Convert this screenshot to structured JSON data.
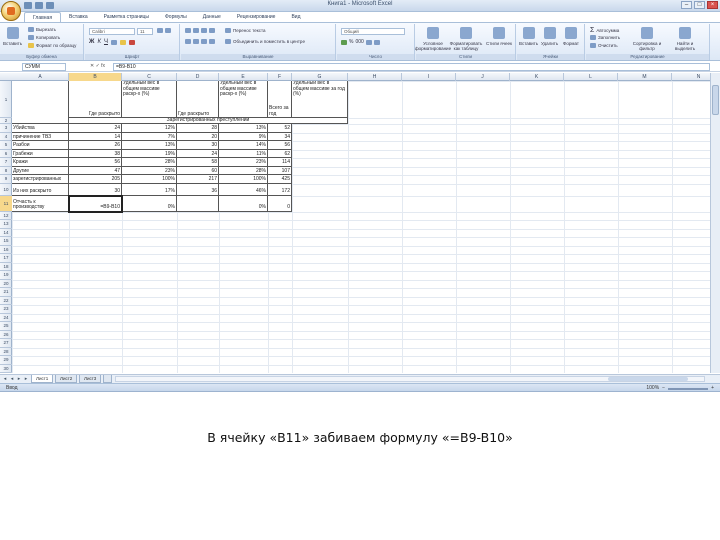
{
  "window": {
    "title": "Книга1 - Microsoft Excel"
  },
  "tabs": [
    "Главная",
    "Вставка",
    "Разметка страницы",
    "Формулы",
    "Данные",
    "Рецензирование",
    "Вид"
  ],
  "ribbon": {
    "paste": "Вставить",
    "cut": "Вырезать",
    "copy": "Копировать",
    "format_painter": "Формат по образцу",
    "font_name": "Calibri",
    "font_size": "11",
    "wrap_text": "Перенос текста",
    "merge_center": "Объединить и поместить в центре",
    "number_format": "Общий",
    "cond_format": "Условное форматирование",
    "format_table": "Форматировать как таблицу",
    "cell_styles": "Стили ячеек",
    "insert": "Вставить",
    "delete": "Удалить",
    "format": "Формат",
    "autosum": "Автосумма",
    "fill": "Заполнить",
    "clear": "Очистить",
    "sort_filter": "Сортировка и фильтр",
    "find_select": "Найти и выделить",
    "groups": [
      "Буфер обмена",
      "Шрифт",
      "Выравнивание",
      "Число",
      "Стили",
      "Ячейки",
      "Редактирование"
    ]
  },
  "formula_bar": {
    "name_box": "СУММ",
    "fx": "✕ ✓ fx",
    "formula": "=B9-B10"
  },
  "columns": [
    "A",
    "B",
    "C",
    "D",
    "E",
    "F",
    "G",
    "H",
    "I",
    "J",
    "K",
    "L",
    "M",
    "N",
    "O",
    "P"
  ],
  "rows": [
    "1",
    "2",
    "3",
    "4",
    "5",
    "6",
    "7",
    "8",
    "9",
    "10",
    "11",
    "12",
    "13",
    "14",
    "15",
    "16",
    "17",
    "18",
    "19",
    "20",
    "21",
    "22",
    "23",
    "24",
    "25",
    "26",
    "27",
    "28",
    "29",
    "30",
    "31"
  ],
  "table": {
    "header": {
      "b": "Где раскрыто",
      "c": "Удельный вес в общем массиве раскр-х (%)",
      "d": "Где раскрыто",
      "e": "Удельный вес в общем массиве раскр-х (%)",
      "f": "Всего за год",
      "g": "Удельный вес в общем массиве за год (%)",
      "sub": "Зарегистрированных преступлений"
    },
    "rows": [
      [
        "Убийства",
        "24",
        "12%",
        "28",
        "13%",
        "52"
      ],
      [
        "Умышленное причинение ТВЗ",
        "14",
        "7%",
        "20",
        "9%",
        "34"
      ],
      [
        "Разбои",
        "26",
        "13%",
        "30",
        "14%",
        "56"
      ],
      [
        "Грабежи",
        "38",
        "19%",
        "24",
        "11%",
        "62"
      ],
      [
        "Кражи",
        "56",
        "28%",
        "58",
        "23%",
        "114"
      ],
      [
        "Другие",
        "47",
        "23%",
        "60",
        "28%",
        "107"
      ],
      [
        "Всего зарегистрированных",
        "205",
        "100%",
        "217",
        "100%",
        "425"
      ],
      [
        "Из них раскрыто",
        "30",
        "17%",
        "36",
        "46%",
        "172"
      ],
      [
        "Отчасть к производству",
        "=B9-B10",
        "0%",
        "",
        "0%",
        "0"
      ]
    ]
  },
  "sheets": [
    "Лист1",
    "Лист2",
    "Лист3"
  ],
  "status": "Ввод",
  "zoom": "100%",
  "caption": "В ячейку «B11» забиваем формулу «=B9-B10»"
}
